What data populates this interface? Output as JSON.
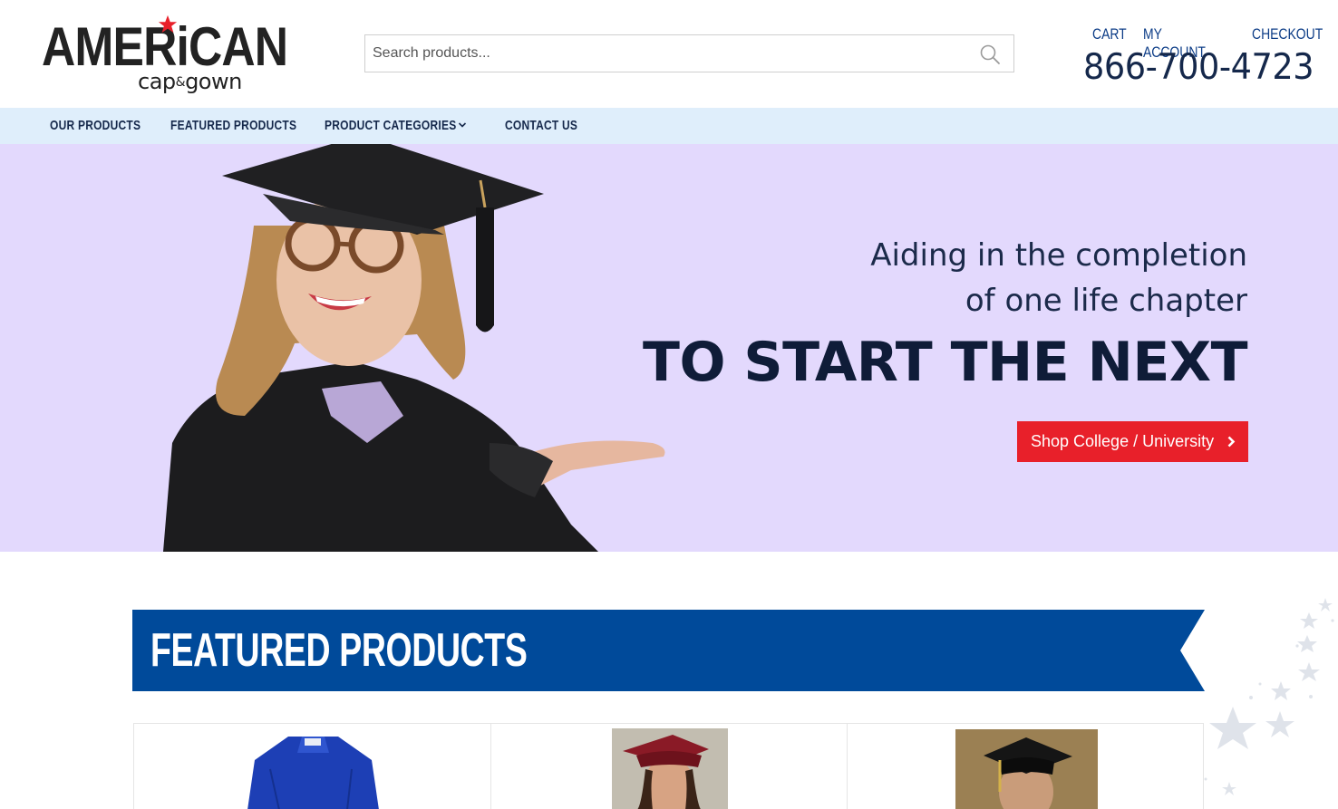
{
  "header": {
    "logo": {
      "main": "AMERiCAN",
      "sub_left": "cap",
      "sub_amp": "&",
      "sub_right": "gown"
    },
    "search": {
      "placeholder": "Search products..."
    },
    "top_links": [
      "CART",
      "MY ACCOUNT",
      "CHECKOUT"
    ],
    "phone": "866-700-4723"
  },
  "nav": {
    "items": [
      "OUR PRODUCTS",
      "FEATURED PRODUCTS",
      "PRODUCT CATEGORIES",
      "CONTACT US"
    ]
  },
  "hero": {
    "line1": "Aiding in the completion",
    "line2": "of one life chapter",
    "headline": "TO START THE NEXT",
    "button_label": "Shop College / University"
  },
  "featured": {
    "title": "FEATURED PRODUCTS",
    "products": [
      {
        "icon": "blue-gown-image"
      },
      {
        "icon": "maroon-cap-student-image"
      },
      {
        "icon": "black-cap-student-image"
      }
    ]
  },
  "colors": {
    "brand_blue": "#004a9a",
    "nav_bg": "#dfeefb",
    "hero_bg": "#e3d9fd",
    "accent_red": "#e8202a",
    "text_dark": "#15284b"
  }
}
